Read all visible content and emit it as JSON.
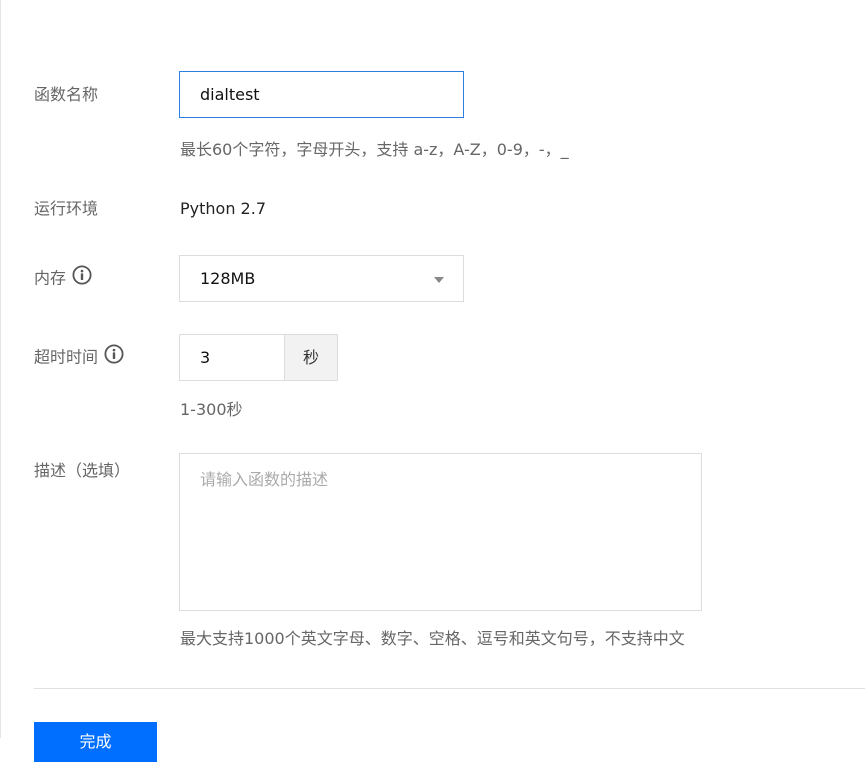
{
  "form": {
    "function_name": {
      "label": "函数名称",
      "value": "dialtest",
      "hint": "最长60个字符，字母开头，支持 a-z，A-Z，0-9，-，_"
    },
    "runtime": {
      "label": "运行环境",
      "value": "Python 2.7"
    },
    "memory": {
      "label": "内存",
      "selected": "128MB"
    },
    "timeout": {
      "label": "超时时间",
      "value": "3",
      "unit": "秒",
      "hint": "1-300秒"
    },
    "description": {
      "label": "描述（选填）",
      "placeholder": "请输入函数的描述",
      "hint": "最大支持1000个英文字母、数字、空格、逗号和英文句号，不支持中文"
    }
  },
  "actions": {
    "submit_label": "完成"
  },
  "colors": {
    "accent": "#006eff",
    "focus_border": "#2f7fe0",
    "border": "#dddddd"
  }
}
